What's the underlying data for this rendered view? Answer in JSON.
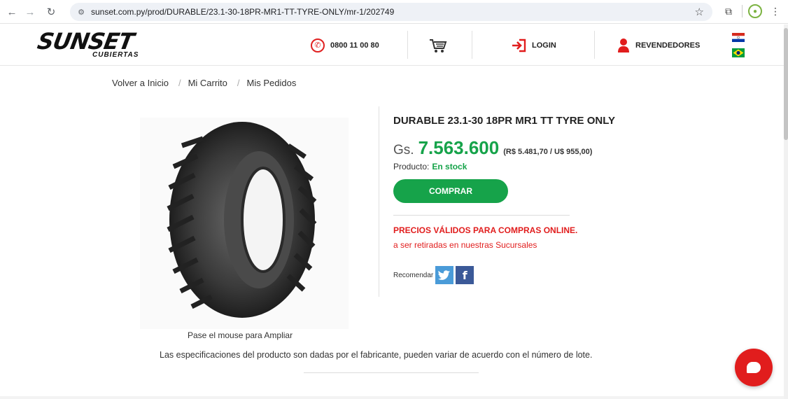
{
  "browser": {
    "url": "sunset.com.py/prod/DURABLE/23.1-30-18PR-MR1-TT-TYRE-ONLY/mr-1/202749"
  },
  "header": {
    "logo_main": "SUNSET",
    "logo_sub": "CUBIERTAS",
    "phone": "0800 11 00 80",
    "login": "LOGIN",
    "resellers": "REVENDEDORES"
  },
  "breadcrumb": {
    "items": [
      "Volver a Inicio",
      "Mi Carrito",
      "Mis Pedidos"
    ],
    "separator": "/"
  },
  "product": {
    "title": "DURABLE 23.1-30 18PR MR1 TT TYRE ONLY",
    "currency": "Gs.",
    "price": "7.563.600",
    "alt_price": "(R$ 5.481,70 / U$ 955,00)",
    "stock_label": "Producto:",
    "stock_value": "En stock",
    "buy_label": "COMPRAR",
    "valid_notice": "PRECIOS VÁLIDOS PARA COMPRAS ONLINE.",
    "pickup_notice": "a ser retiradas en nuestras Sucursales",
    "recommend_label": "Recomendar",
    "image_caption": "Pase el mouse para Ampliar",
    "spec_notice": "Las especificaciones del producto son dadas por el fabricante, pueden variar de acuerdo con el número de lote."
  },
  "colors": {
    "brand_red": "#e11d1d",
    "price_green": "#16a34a",
    "twitter_blue": "#4a9bd8",
    "facebook_blue": "#3b5998"
  }
}
